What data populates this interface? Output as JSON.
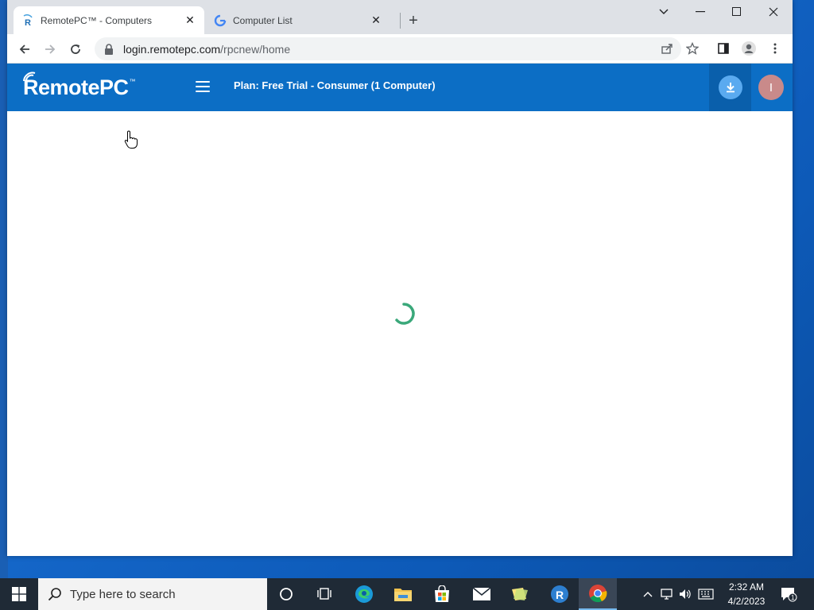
{
  "browser": {
    "tabs": [
      {
        "label": "RemotePC™ - Computers",
        "active": true,
        "favicon": "remotepc-r-icon"
      },
      {
        "label": "Computer List",
        "active": false,
        "favicon": "google-g-icon"
      }
    ],
    "url_host": "login.remotepc.com",
    "url_path": "/rpcnew/home"
  },
  "app": {
    "logo_text": "RemotePC",
    "logo_tm": "™",
    "plan_text": "Plan: Free Trial - Consumer (1 Computer)",
    "avatar_initial": "I",
    "brand_color": "#0c6ec5"
  },
  "taskbar": {
    "search_placeholder": "Type here to search",
    "time": "2:32 AM",
    "date": "4/2/2023",
    "notification_count": "1",
    "pinned": [
      "cortana-icon",
      "task-view-icon",
      "edge-icon",
      "file-explorer-icon",
      "store-icon",
      "mail-icon",
      "sticky-notes-icon",
      "remotepc-icon",
      "chrome-icon"
    ]
  }
}
